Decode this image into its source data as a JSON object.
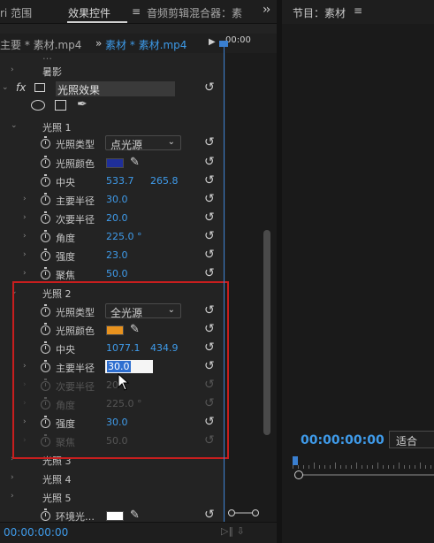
{
  "left_panel": {
    "tabs": {
      "scope": "ri 范围",
      "effect_controls": "效果控件",
      "audio_mixer": "音频剪辑混合器：素"
    },
    "clip": {
      "master": "主要 * 素材.mp4",
      "separator": "»",
      "sequence": "素材 * 素材.mp4"
    },
    "ruler_time": "00:00",
    "properties": {
      "row_cut_top": "…",
      "shadow": "暑影",
      "effect_name": "光照效果",
      "light1": {
        "section": "光照 1",
        "type_label": "光照类型",
        "type_value": "点光源",
        "color_label": "光照颜色",
        "color": "#1f2f9a",
        "center_label": "中央",
        "center_x": "533.7",
        "center_y": "265.8",
        "major_label": "主要半径",
        "major_value": "30.0",
        "minor_label": "次要半径",
        "minor_value": "20.0",
        "angle_label": "角度",
        "angle_value": "225.0 °",
        "intensity_label": "强度",
        "intensity_value": "23.0",
        "focus_label": "聚焦",
        "focus_value": "50.0"
      },
      "light2": {
        "section": "光照 2",
        "type_label": "光照类型",
        "type_value": "全光源",
        "color_label": "光照颜色",
        "color": "#e8921e",
        "center_label": "中央",
        "center_x": "1077.1",
        "center_y": "434.9",
        "major_label": "主要半径",
        "major_value": "30.0",
        "minor_label": "次要半径",
        "minor_value": "20",
        "angle_label": "角度",
        "angle_value": "225.0 °",
        "intensity_label": "强度",
        "intensity_value": "30.0",
        "focus_label": "聚焦",
        "focus_value": "50.0"
      },
      "light3": "光照 3",
      "light4": "光照 4",
      "light5": "光照 5",
      "ambient_label": "环境光…",
      "ambient_color": "#ffffff"
    },
    "bottom_time": "00:00:00:00"
  },
  "right_panel": {
    "title": "节目：素材",
    "timecode": "00:00:00:00",
    "fit": "适合"
  },
  "colors": {
    "accent": "#3f9bea",
    "highlight_box": "#c81e1e"
  }
}
